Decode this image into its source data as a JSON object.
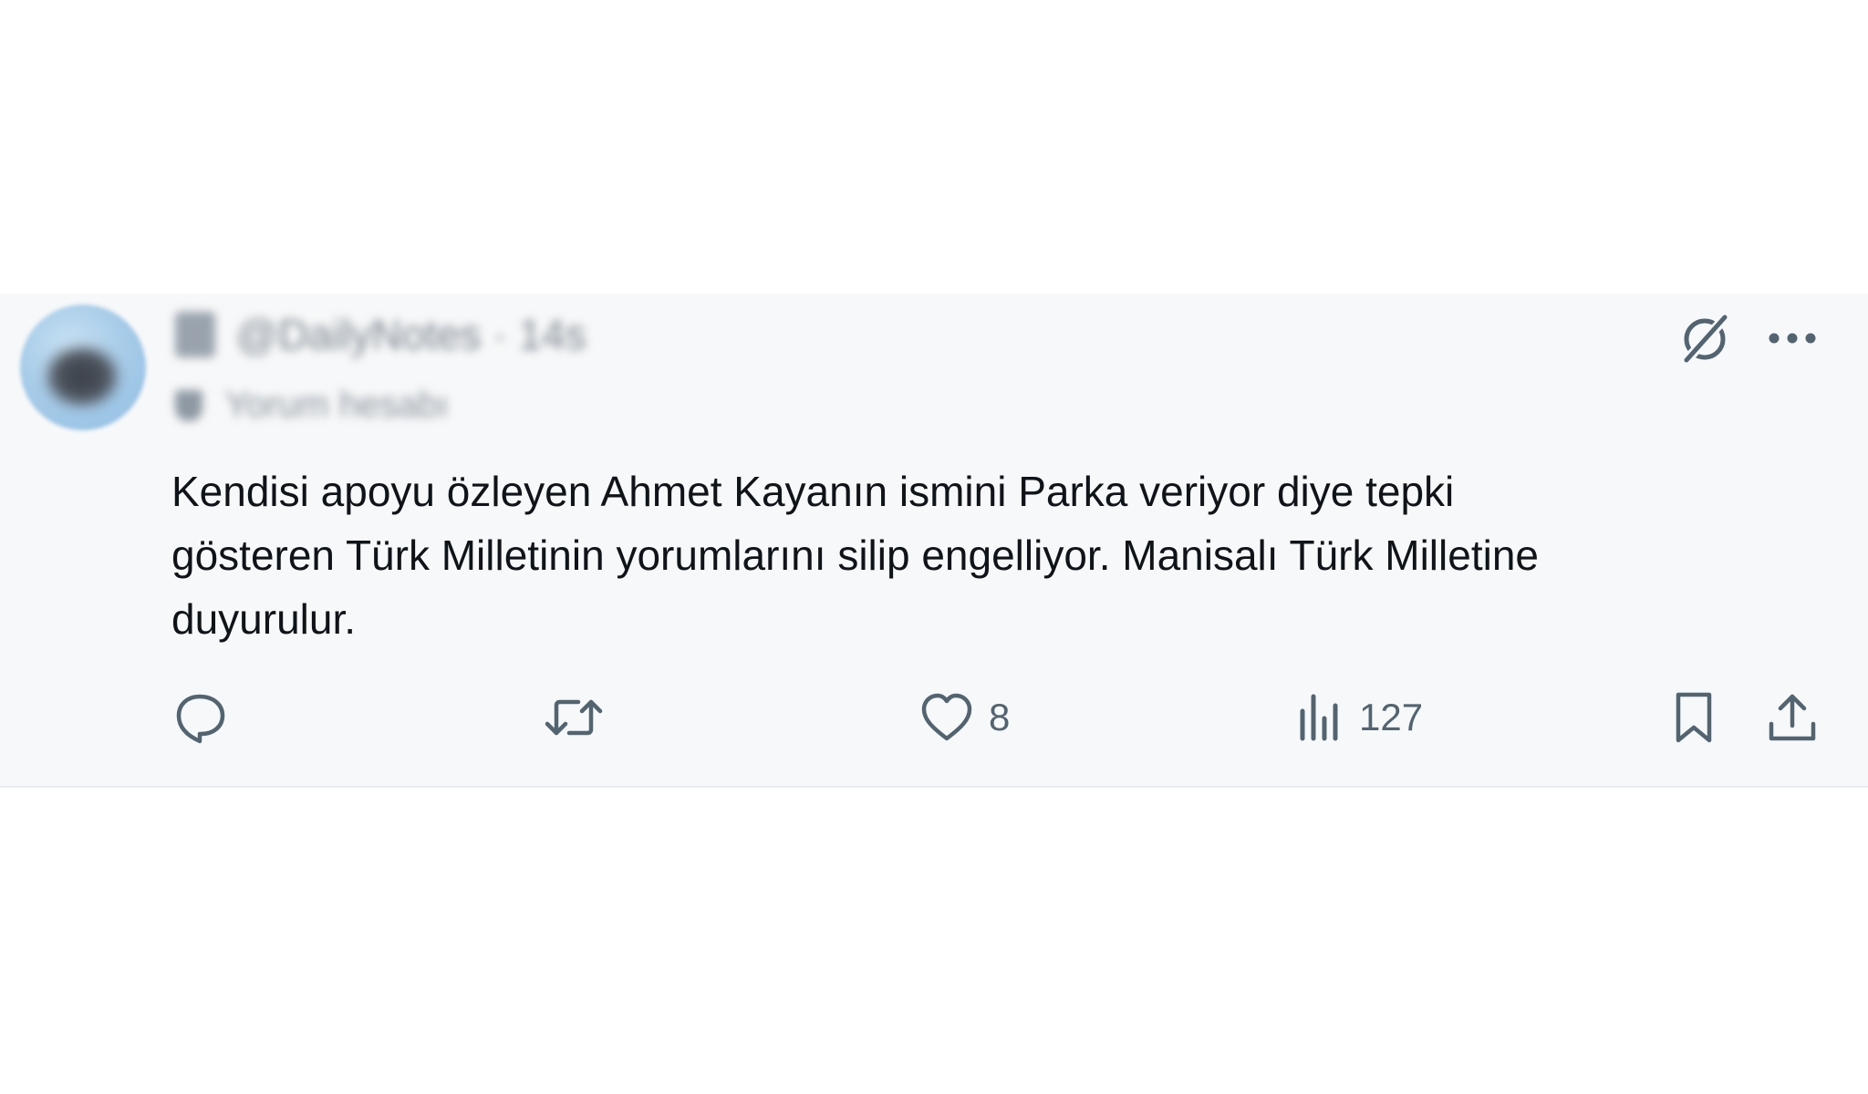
{
  "tweet": {
    "author": {
      "handle": "@DailyNotes",
      "time": "14s",
      "sub_label": "Yorum hesabı"
    },
    "text": "Kendisi apoyu özleyen Ahmet Kayanın ismini Parka veriyor diye tepki\ngösteren Türk Milletinin yorumlarını silip engelliyor. Manisalı Türk Milletine\nduyurulur.",
    "actions": {
      "likes": "8",
      "views": "127"
    },
    "icons": {
      "reply": "reply-icon",
      "retweet": "retweet-icon",
      "like": "heart-icon",
      "views": "views-chart-icon",
      "bookmark": "bookmark-icon",
      "share": "share-icon",
      "grok": "grok-icon",
      "more": "more-dots-icon"
    },
    "colors": {
      "icon": "#536471",
      "text": "#0f1419"
    }
  }
}
